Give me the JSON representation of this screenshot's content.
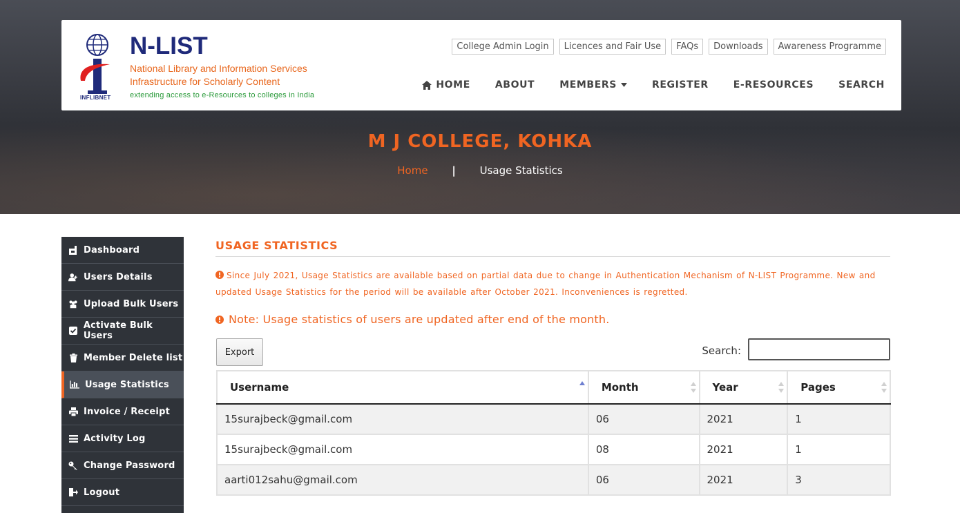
{
  "header": {
    "logo": {
      "title": "N-LIST",
      "line1": "National Library and Information Services",
      "line2": "Infrastructure for Scholarly Content",
      "tagline": "extending access to e-Resources to colleges in India",
      "org": "INFLIBNET"
    },
    "top_links": [
      "College Admin Login",
      "Licences and Fair Use",
      "FAQs",
      "Downloads",
      "Awareness Programme"
    ],
    "nav": {
      "home": "HOME",
      "about": "ABOUT",
      "members": "MEMBERS",
      "register": "REGISTER",
      "eresources": "E-RESOURCES",
      "search": "SEARCH"
    }
  },
  "hero": {
    "college": "M J COLLEGE, KOHKA",
    "breadcrumb_home": "Home",
    "breadcrumb_sep": "|",
    "breadcrumb_current": "Usage Statistics"
  },
  "sidebar": {
    "items": [
      {
        "label": "Dashboard",
        "icon": "dashboard-icon"
      },
      {
        "label": "Users Details",
        "icon": "users-icon"
      },
      {
        "label": "Upload Bulk Users",
        "icon": "group-icon"
      },
      {
        "label": "Activate Bulk Users",
        "icon": "check-square-icon"
      },
      {
        "label": "Member Delete list",
        "icon": "trash-icon"
      },
      {
        "label": "Usage Statistics",
        "icon": "bar-chart-icon",
        "active": true
      },
      {
        "label": "Invoice / Receipt",
        "icon": "printer-icon"
      },
      {
        "label": "Activity Log",
        "icon": "list-icon"
      },
      {
        "label": "Change Password",
        "icon": "key-icon"
      },
      {
        "label": "Logout",
        "icon": "logout-icon"
      }
    ]
  },
  "main": {
    "title": "USAGE STATISTICS",
    "notice_partial": "Since July 2021, Usage Statistics are available based on partial data due to change in Authentication Mechanism of N-LIST Programme. New and updated Usage Statistics for the period will be available after October 2021. Inconveniences is regretted.",
    "notice_monthly": "Note: Usage statistics of users are updated after end of the month.",
    "export_label": "Export",
    "search_label": "Search:",
    "search_value": "",
    "table": {
      "columns": [
        "Username",
        "Month",
        "Year",
        "Pages"
      ],
      "rows": [
        [
          "15surajbeck@gmail.com",
          "06",
          "2021",
          "1"
        ],
        [
          "15surajbeck@gmail.com",
          "08",
          "2021",
          "1"
        ],
        [
          "aarti012sahu@gmail.com",
          "06",
          "2021",
          "3"
        ]
      ]
    }
  },
  "colors": {
    "accent": "#f06522",
    "sidebar_bg": "#2f3339",
    "sidebar_active_bg": "#4a5059",
    "logo_blue": "#1f2a7a",
    "logo_green": "#2a9a3a"
  }
}
